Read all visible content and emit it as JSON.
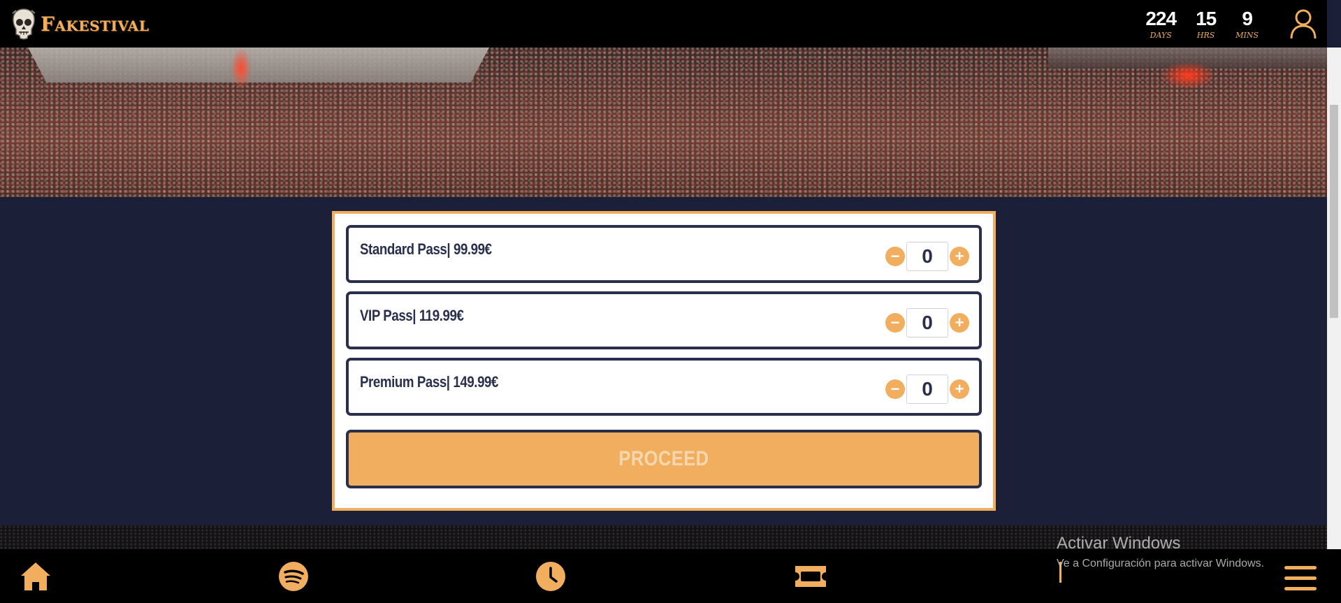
{
  "header": {
    "brand": "Fakestival",
    "countdown": [
      {
        "value": "224",
        "label": "DAYS"
      },
      {
        "value": "15",
        "label": "HRS"
      },
      {
        "value": "9",
        "label": "MINS"
      }
    ]
  },
  "passes": [
    {
      "label": "Standard Pass| 99.99€",
      "quantity": "0"
    },
    {
      "label": "VIP Pass| 119.99€",
      "quantity": "0"
    },
    {
      "label": "Premium Pass| 149.99€",
      "quantity": "0"
    }
  ],
  "stepper": {
    "minus": "−",
    "plus": "+"
  },
  "proceed_label": "PROCEED",
  "bottom_nav": [
    "home-icon",
    "spotify-icon",
    "clock-icon",
    "ticket-icon",
    "menu-icon"
  ],
  "windows_watermark": {
    "title": "Activar Windows",
    "subtitle": "Ve a Configuración para activar Windows."
  },
  "colors": {
    "accent": "#f0ae5e",
    "navy": "#2a2f4d",
    "background": "#1b2038",
    "bar": "#000000"
  }
}
